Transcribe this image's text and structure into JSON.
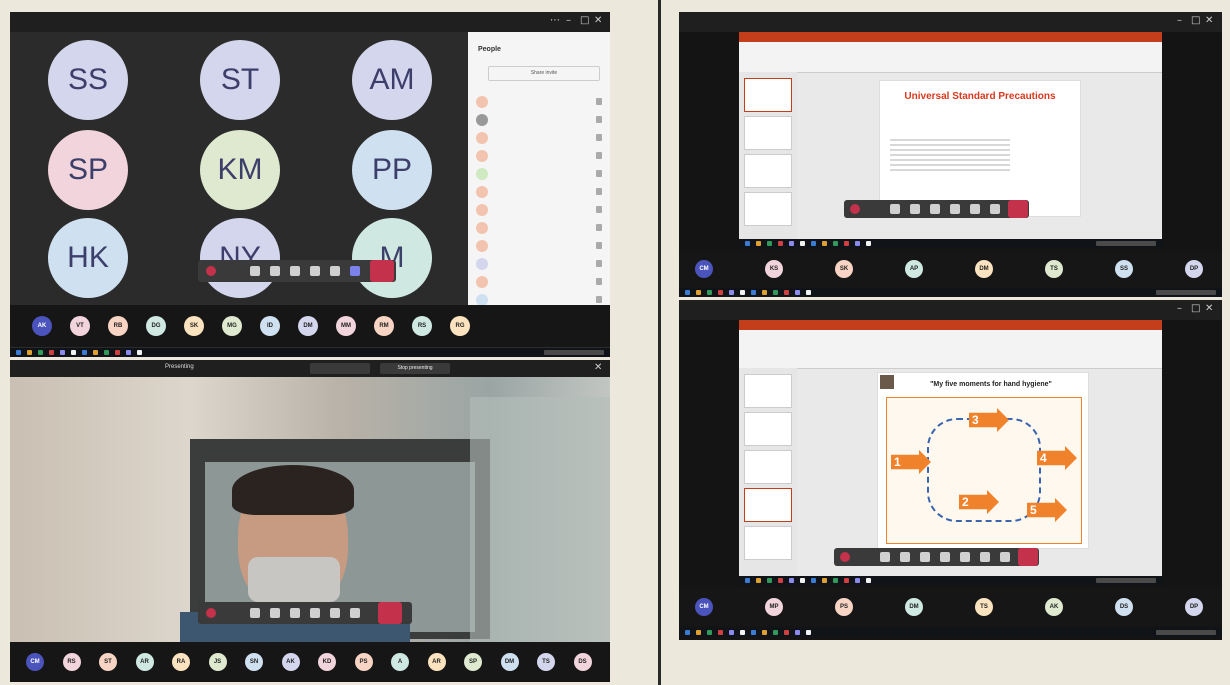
{
  "panels": {
    "gallery": {
      "participants": [
        {
          "initials": "SS",
          "color": "#d4d6ee"
        },
        {
          "initials": "ST",
          "color": "#d4d6ee"
        },
        {
          "initials": "AM",
          "color": "#d4d6ee"
        },
        {
          "initials": "SP",
          "color": "#f2d4dc"
        },
        {
          "initials": "KM",
          "color": "#dfe9cf"
        },
        {
          "initials": "PP",
          "color": "#cfe0f0"
        },
        {
          "initials": "HK",
          "color": "#cfe0f0"
        },
        {
          "initials": "NY",
          "color": "#d4d6ee"
        },
        {
          "initials": "M",
          "color": "#cfe9e2"
        }
      ],
      "people_panel": {
        "title": "People",
        "share_invite": "Share invite",
        "rows": [
          "",
          "",
          "",
          "",
          "",
          "",
          "",
          "",
          "",
          "",
          "",
          "",
          ""
        ]
      },
      "strip_initials": [
        "AK",
        "VT",
        "RB",
        "DG",
        "SK",
        "MG",
        "ID",
        "DM",
        "MM",
        "RM",
        "RS",
        "RG"
      ]
    },
    "presenting": {
      "label": "Presenting",
      "stop_presenting": "Stop presenting",
      "strip_initials": [
        "CM",
        "RS",
        "ST",
        "AR",
        "RA",
        "JS",
        "SN",
        "AK",
        "KD",
        "PS",
        "A",
        "AR",
        "SP",
        "DM",
        "TS",
        "DS"
      ]
    },
    "slide1": {
      "title": "Universal Standard Precautions",
      "strip_initials": [
        "CM",
        "KS",
        "SK",
        "AP",
        "DM",
        "TS",
        "SS",
        "DP"
      ]
    },
    "slide2": {
      "title": "\"My five moments for hand hygiene\"",
      "moments": [
        "1",
        "2",
        "3",
        "4",
        "5"
      ],
      "strip_initials": [
        "CM",
        "MP",
        "PS",
        "DM",
        "TS",
        "AK",
        "DS",
        "DP"
      ]
    }
  },
  "colors": {
    "hangup": "#c4314b",
    "powerpoint": "#c43e1c",
    "slide_title_red": "#d9381e",
    "hygiene_orange": "#f0822c"
  }
}
